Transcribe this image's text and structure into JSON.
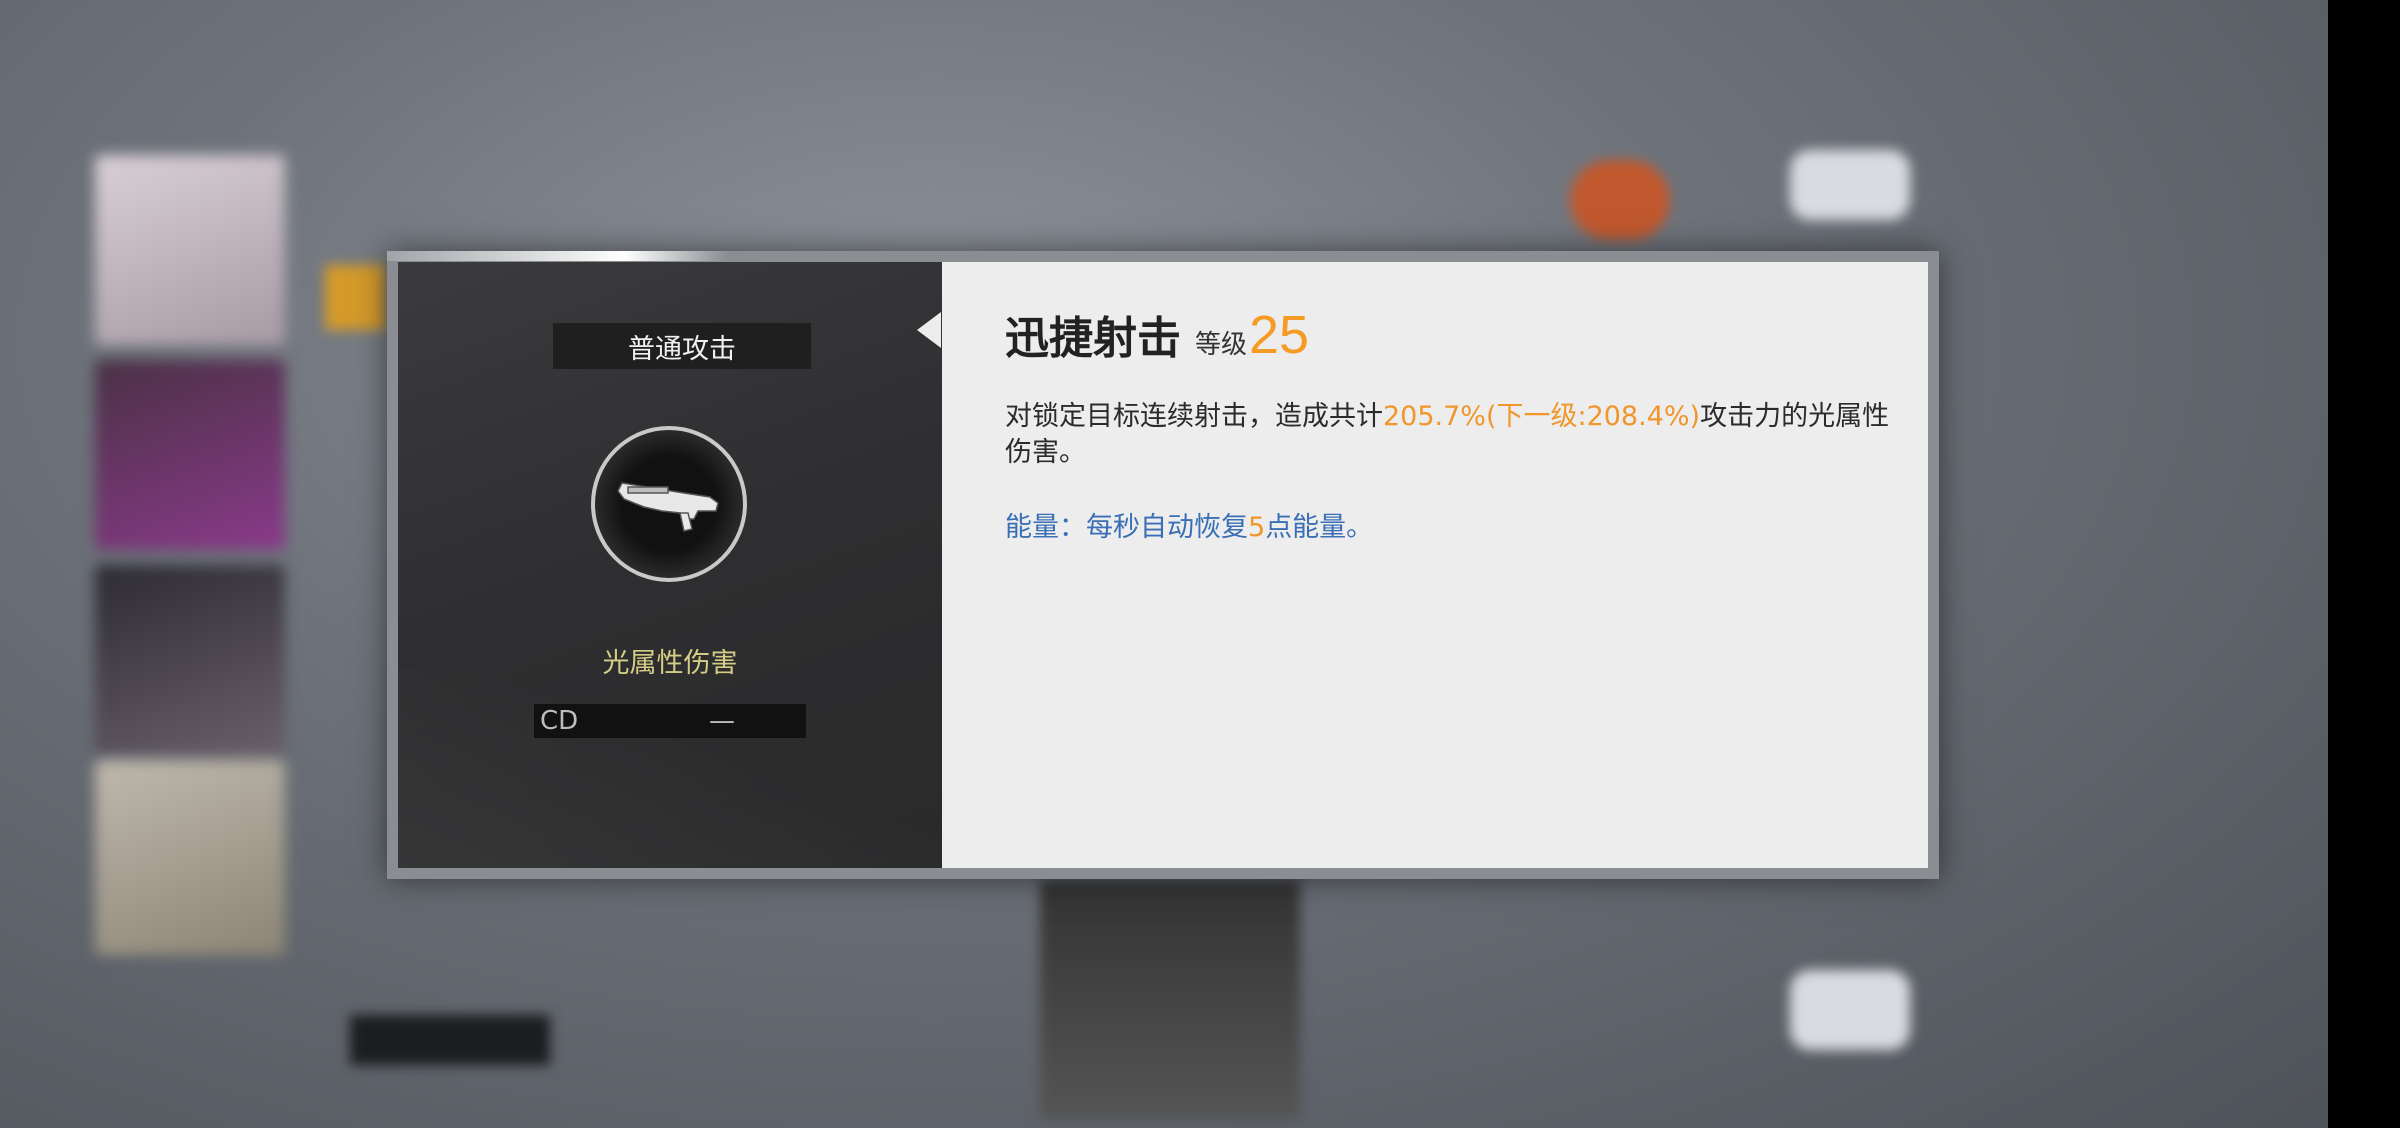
{
  "skill_panel": {
    "skill_type": "普通攻击",
    "element": "光属性伤害",
    "cd_label": "CD",
    "cd_value": "—",
    "skill_icon": "rifle-icon"
  },
  "skill_detail": {
    "name": "迅捷射击",
    "level_label": "等级",
    "level_value": "25",
    "desc_prefix": "对锁定目标连续射击，造成共计",
    "desc_highlight": "205.7%(下一级:208.4%)",
    "desc_suffix": "攻击力的光属性伤害。",
    "energy_prefix": "能量：每秒自动恢复",
    "energy_value": "5",
    "energy_suffix": "点能量。"
  },
  "colors": {
    "accent_orange": "#f59a23",
    "energy_blue": "#3a6fb5",
    "element_yellow": "#d4cd86"
  }
}
